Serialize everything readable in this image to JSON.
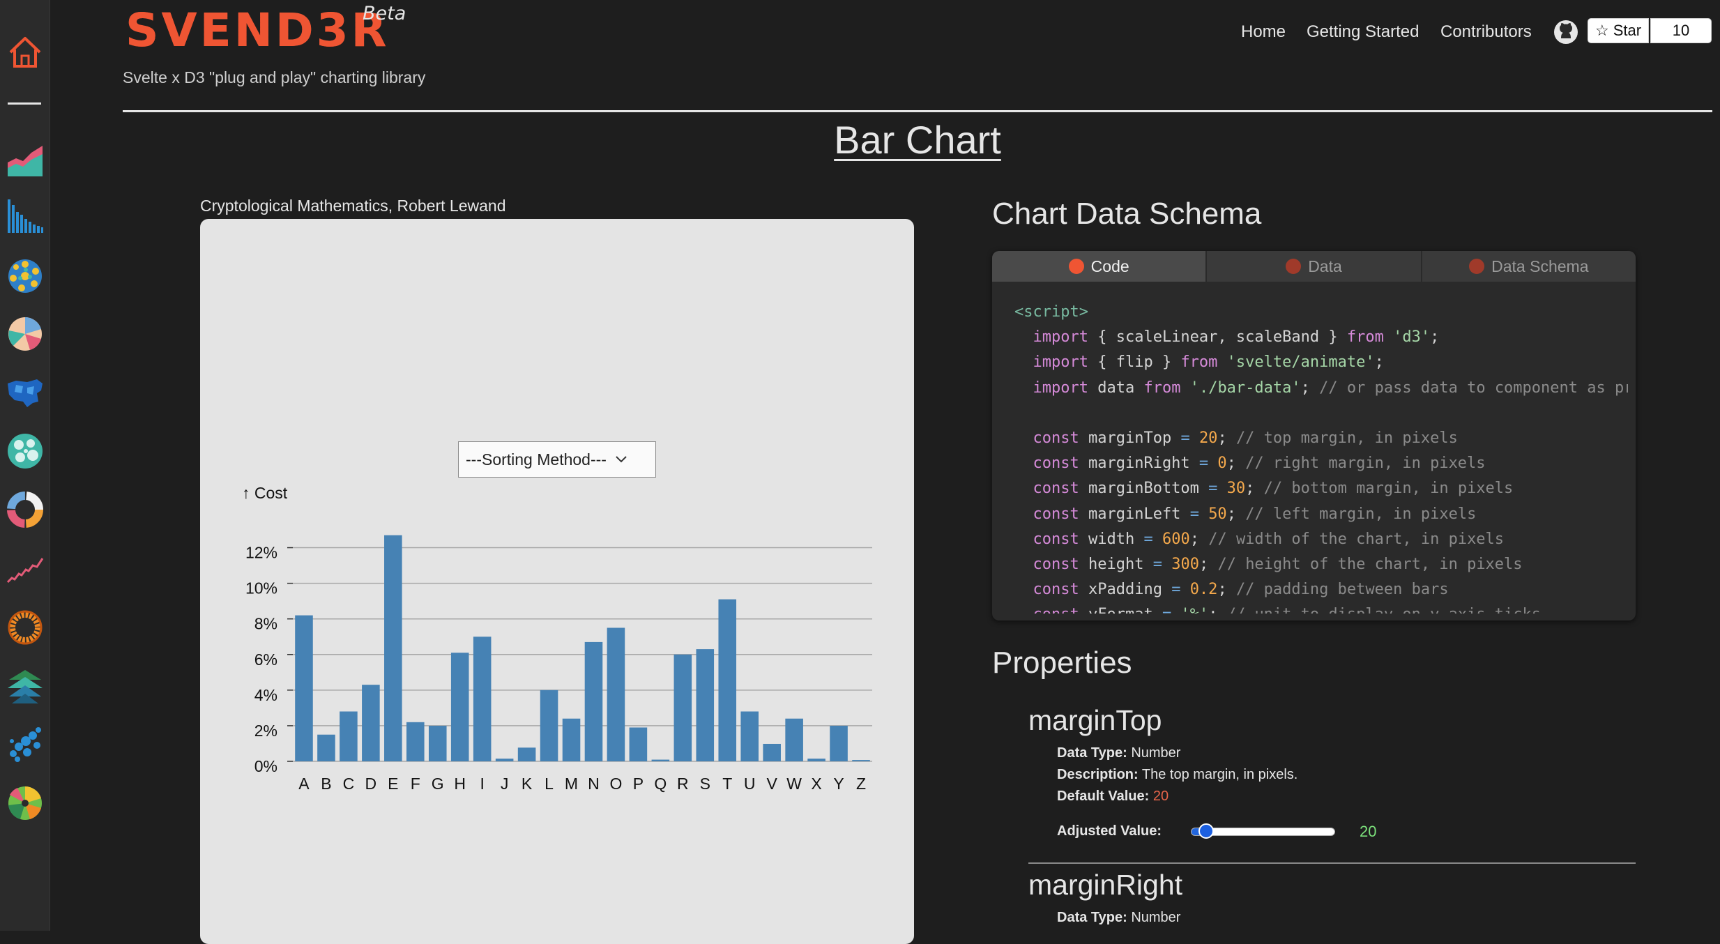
{
  "header": {
    "logo": "SVEND3R",
    "beta": "Beta",
    "tagline": "Svelte x D3 \"plug and play\" charting library",
    "nav": [
      "Home",
      "Getting Started",
      "Contributors"
    ],
    "star_label": "Star",
    "star_count": "10"
  },
  "sidebar": {
    "items": [
      "home-icon",
      "area-chart-icon",
      "bar-chart-icon",
      "bubble-icon",
      "radial-icon",
      "map-icon",
      "circle-pack-icon",
      "donut-icon",
      "line-chart-icon",
      "ring-icon",
      "tree-icon",
      "scatter-icon",
      "pie-icon"
    ],
    "accent": "#ef5533"
  },
  "page": {
    "title": "Bar Chart"
  },
  "chart": {
    "caption": "Cryptological Mathematics, Robert Lewand",
    "sort_placeholder": "---Sorting Method---"
  },
  "chart_data": {
    "type": "bar",
    "ylabel": "↑ Cost",
    "ylim": [
      0,
      0.13
    ],
    "yticks": [
      "0%",
      "2%",
      "4%",
      "6%",
      "8%",
      "10%",
      "12%"
    ],
    "bar_color": "#4682b4",
    "categories": [
      "A",
      "B",
      "C",
      "D",
      "E",
      "F",
      "G",
      "H",
      "I",
      "J",
      "K",
      "L",
      "M",
      "N",
      "O",
      "P",
      "Q",
      "R",
      "S",
      "T",
      "U",
      "V",
      "W",
      "X",
      "Y",
      "Z"
    ],
    "values": [
      0.082,
      0.015,
      0.028,
      0.043,
      0.127,
      0.022,
      0.02,
      0.061,
      0.07,
      0.0015,
      0.0077,
      0.04,
      0.024,
      0.067,
      0.075,
      0.019,
      0.00095,
      0.06,
      0.063,
      0.091,
      0.028,
      0.0098,
      0.024,
      0.0015,
      0.02,
      0.00074
    ]
  },
  "schema": {
    "title": "Chart Data Schema",
    "tabs": [
      "Code",
      "Data",
      "Data Schema"
    ],
    "tab_colors": [
      "#ef5533",
      "#a03a2a",
      "#a03a2a"
    ]
  },
  "code": [
    [
      [
        "<script>",
        "tag"
      ]
    ],
    [
      [
        "  ",
        ""
      ],
      [
        "import",
        "kw"
      ],
      [
        " { scaleLinear, scaleBand } ",
        ""
      ],
      [
        "from",
        "kw"
      ],
      [
        " ",
        ""
      ],
      [
        "'d3'",
        "str"
      ],
      [
        ";",
        ""
      ]
    ],
    [
      [
        "  ",
        ""
      ],
      [
        "import",
        "kw"
      ],
      [
        " { flip } ",
        ""
      ],
      [
        "from",
        "kw"
      ],
      [
        " ",
        ""
      ],
      [
        "'svelte/animate'",
        "str"
      ],
      [
        ";",
        ""
      ]
    ],
    [
      [
        "  ",
        ""
      ],
      [
        "import",
        "kw"
      ],
      [
        " data ",
        ""
      ],
      [
        "from",
        "kw"
      ],
      [
        " ",
        ""
      ],
      [
        "'./bar-data'",
        "str"
      ],
      [
        "; ",
        ""
      ],
      [
        "// or pass data to component as pro",
        "cm"
      ]
    ],
    [
      [
        "",
        ""
      ]
    ],
    [
      [
        "  ",
        ""
      ],
      [
        "const",
        "kw"
      ],
      [
        " marginTop ",
        ""
      ],
      [
        "=",
        "op"
      ],
      [
        " ",
        ""
      ],
      [
        "20",
        "num"
      ],
      [
        "; ",
        ""
      ],
      [
        "// top margin, in pixels",
        "cm"
      ]
    ],
    [
      [
        "  ",
        ""
      ],
      [
        "const",
        "kw"
      ],
      [
        " marginRight ",
        ""
      ],
      [
        "=",
        "op"
      ],
      [
        " ",
        ""
      ],
      [
        "0",
        "num"
      ],
      [
        "; ",
        ""
      ],
      [
        "// right margin, in pixels",
        "cm"
      ]
    ],
    [
      [
        "  ",
        ""
      ],
      [
        "const",
        "kw"
      ],
      [
        " marginBottom ",
        ""
      ],
      [
        "=",
        "op"
      ],
      [
        " ",
        ""
      ],
      [
        "30",
        "num"
      ],
      [
        "; ",
        ""
      ],
      [
        "// bottom margin, in pixels",
        "cm"
      ]
    ],
    [
      [
        "  ",
        ""
      ],
      [
        "const",
        "kw"
      ],
      [
        " marginLeft ",
        ""
      ],
      [
        "=",
        "op"
      ],
      [
        " ",
        ""
      ],
      [
        "50",
        "num"
      ],
      [
        "; ",
        ""
      ],
      [
        "// left margin, in pixels",
        "cm"
      ]
    ],
    [
      [
        "  ",
        ""
      ],
      [
        "const",
        "kw"
      ],
      [
        " width ",
        ""
      ],
      [
        "=",
        "op"
      ],
      [
        " ",
        ""
      ],
      [
        "600",
        "num"
      ],
      [
        "; ",
        ""
      ],
      [
        "// width of the chart, in pixels",
        "cm"
      ]
    ],
    [
      [
        "  ",
        ""
      ],
      [
        "const",
        "kw"
      ],
      [
        " height ",
        ""
      ],
      [
        "=",
        "op"
      ],
      [
        " ",
        ""
      ],
      [
        "300",
        "num"
      ],
      [
        "; ",
        ""
      ],
      [
        "// height of the chart, in pixels",
        "cm"
      ]
    ],
    [
      [
        "  ",
        ""
      ],
      [
        "const",
        "kw"
      ],
      [
        " xPadding ",
        ""
      ],
      [
        "=",
        "op"
      ],
      [
        " ",
        ""
      ],
      [
        "0.2",
        "num"
      ],
      [
        "; ",
        ""
      ],
      [
        "// padding between bars",
        "cm"
      ]
    ],
    [
      [
        "  ",
        ""
      ],
      [
        "const",
        "kw"
      ],
      [
        " yFormat ",
        ""
      ],
      [
        "=",
        "op"
      ],
      [
        " ",
        ""
      ],
      [
        "'%'",
        "str"
      ],
      [
        "; ",
        ""
      ],
      [
        "// unit to display on y-axis ticks",
        "cm"
      ]
    ]
  ],
  "properties": {
    "title": "Properties",
    "items": [
      {
        "name": "marginTop",
        "type_label": "Data Type:",
        "type": " Number",
        "desc_label": "Description:",
        "desc": " The top margin, in pixels.",
        "default_label": "Default Value:",
        "default": " 20",
        "adjusted_label": "Adjusted Value:",
        "adjusted": "20",
        "slider_fraction": 0.1
      },
      {
        "name": "marginRight",
        "type_label": "Data Type:",
        "type": " Number"
      }
    ]
  }
}
